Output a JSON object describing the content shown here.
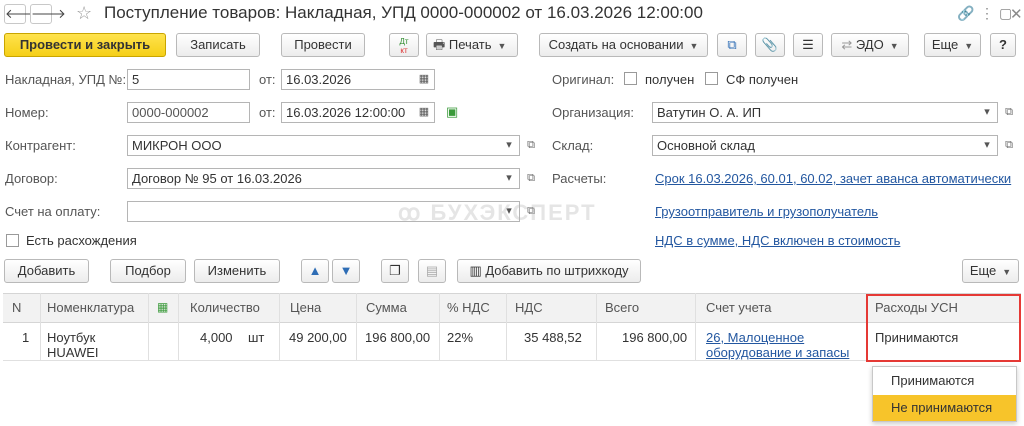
{
  "window": {
    "title": "Поступление товаров: Накладная, УПД 0000-000002 от 16.03.2026 12:00:00"
  },
  "toolbar": {
    "post_close": "Провести и закрыть",
    "save": "Записать",
    "post": "Провести",
    "dtkt_top": "Дт",
    "dtkt_bottom": "кт",
    "print": "Печать",
    "create_based": "Создать на основании",
    "edo": "ЭДО",
    "more": "Еще",
    "help": "?"
  },
  "form": {
    "invoice_label": "Накладная, УПД №:",
    "invoice_value": "5",
    "from_label": "от:",
    "invoice_date": "16.03.2026",
    "number_label": "Номер:",
    "number_value": "0000-000002",
    "number_date": "16.03.2026 12:00:00",
    "counterparty_label": "Контрагент:",
    "counterparty_value": "МИКРОН ООО",
    "contract_label": "Договор:",
    "contract_value": "Договор № 95 от 16.03.2026",
    "payment_label": "Счет на оплату:",
    "payment_value": "",
    "discrepancy_label": "Есть расхождения",
    "original_label": "Оригинал:",
    "received_label": "получен",
    "sf_received_label": "СФ получен",
    "org_label": "Организация:",
    "org_value": "Ватутин О. А. ИП",
    "warehouse_label": "Склад:",
    "warehouse_value": "Основной склад",
    "settlements_label": "Расчеты:",
    "settlements_link": "Срок 16.03.2026, 60.01, 60.02, зачет аванса автоматически",
    "shipper_link": "Грузоотправитель и грузополучатель",
    "vat_link": "НДС в сумме, НДС включен в стоимость",
    "watermark": "БУХЭКСПЕРТ"
  },
  "table_toolbar": {
    "add": "Добавить",
    "pick": "Подбор",
    "change": "Изменить",
    "barcode": "Добавить по штрихкоду",
    "more": "Еще"
  },
  "table": {
    "columns": [
      "N",
      "Номенклатура",
      "Количество",
      "Цена",
      "Сумма",
      "% НДС",
      "НДС",
      "Всего",
      "Счет учета",
      "Расходы УСН"
    ],
    "rows": [
      {
        "n": "1",
        "item_line1": "Ноутбук",
        "item_line2": "HUAWEI",
        "qty": "4,000",
        "unit": "шт",
        "price": "49 200,00",
        "sum": "196 800,00",
        "vat_rate": "22%",
        "vat": "35 488,52",
        "total": "196 800,00",
        "account_line1": "26, Малоценное",
        "account_line2": "оборудование и запасы",
        "usn": "Принимаются"
      }
    ]
  },
  "dropdown": {
    "options": [
      "Принимаются",
      "Не принимаются"
    ],
    "highlighted": "Не принимаются"
  },
  "colors": {
    "primary_button": "#f5cf18",
    "link": "#2357a0",
    "highlight_border": "#e53935",
    "dropdown_highlight": "#f7c42a"
  }
}
